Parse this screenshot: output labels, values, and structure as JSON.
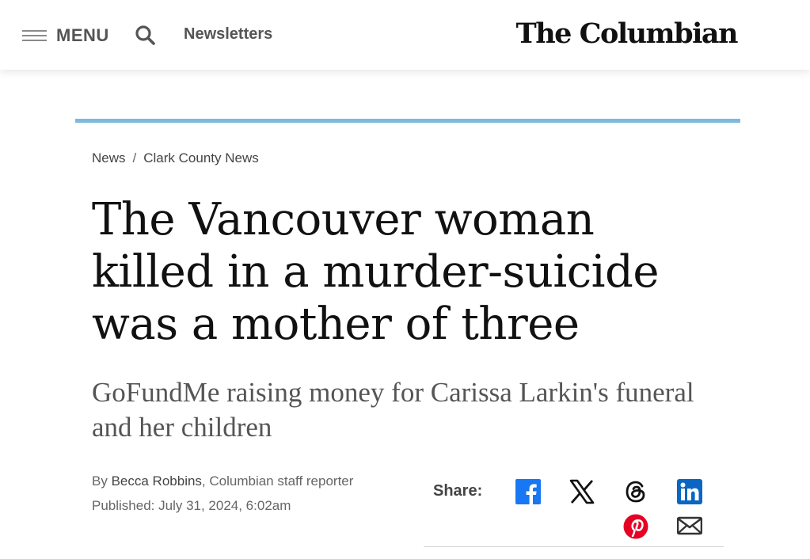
{
  "header": {
    "menu_label": "MENU",
    "newsletters_label": "Newsletters",
    "logo_text": "The Columbian"
  },
  "breadcrumb": {
    "items": [
      "News",
      "Clark County News"
    ],
    "separator": "/"
  },
  "article": {
    "headline": "The Vancouver woman killed in a murder-suicide was a mother of three",
    "subheadline": "GoFundMe raising money for Carissa Larkin's funeral and her children",
    "byline_prefix": "By",
    "author": "Becca Robbins",
    "author_role": ", Columbian staff reporter",
    "published": "Published: July 31, 2024, 6:02am"
  },
  "share": {
    "label": "Share:",
    "icons": [
      "facebook-icon",
      "x-icon",
      "threads-icon",
      "linkedin-icon",
      "pinterest-icon",
      "email-icon"
    ]
  },
  "colors": {
    "accent_rule": "#7fb8de",
    "facebook": "#1877f2",
    "linkedin": "#0a66c2",
    "pinterest": "#e60023",
    "gray_text": "#555555"
  }
}
